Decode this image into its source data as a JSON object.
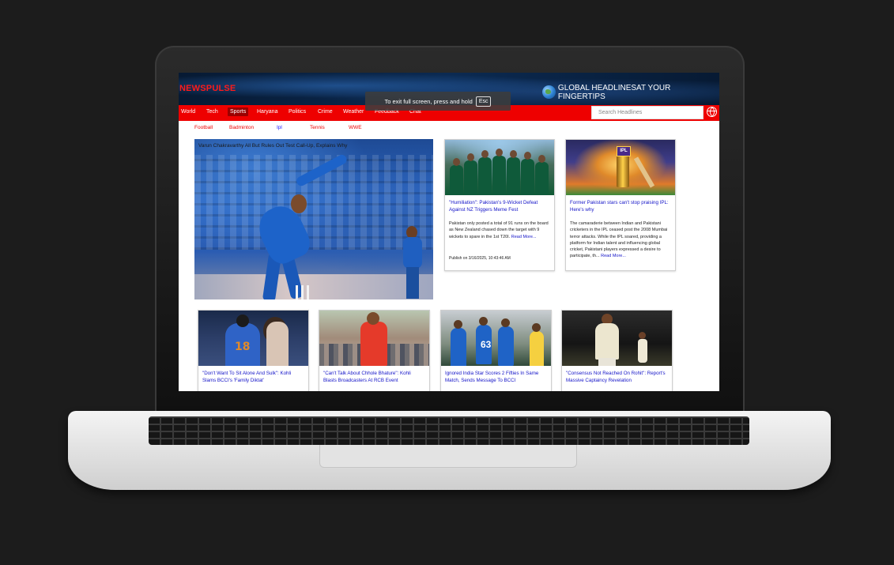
{
  "toast": {
    "text": "To exit full screen, press and hold",
    "key": "Esc"
  },
  "site": {
    "brand": "NEWSPULSE",
    "tagline": "GLOBAL HEADLINESAT YOUR FINGERTIPS"
  },
  "nav": {
    "items": [
      "World",
      "Tech",
      "Sports",
      "Haryana",
      "Politics",
      "Crime",
      "Weather",
      "Feedback",
      "Chat"
    ],
    "active": "Sports",
    "search_placeholder": "Search Headlines"
  },
  "subnav": [
    "Football",
    "Badminton",
    "Ipl",
    "Tennis",
    "WWE"
  ],
  "hero": {
    "title": "Varun Chakravarthy All But Rules Out Test Call-Up, Explains Why"
  },
  "featured": [
    {
      "title": "\"Humiliation\": Pakistan's 9-Wicket Defeat Against NZ Triggers Meme Fest",
      "desc": "Pakistan only posted a total of 91 runs on the board as New Zealand chased down the target with 9 wickets to spare in the 1st T20I.",
      "more": "Read More...",
      "meta": "Publish on 3/16/2025, 10:43:46 AM"
    },
    {
      "title": "Former Pakistan stars can't stop praising IPL: Here's why",
      "desc": "The camaraderie between Indian and Pakistani cricketers in the IPL ceased post the 2008 Mumbai terror attacks. While the IPL soared, providing a platform for Indian talent and influencing global cricket, Pakistani players expressed a desire to participate, th...",
      "more": "Read More..."
    }
  ],
  "row": [
    {
      "title": "\"Don't Want To Sit Alone And Sulk\": Kohli Slams BCCI's 'Family Diktat'"
    },
    {
      "title": "\"Can't Talk About Chhole Bhature\": Kohli Blasts Broadcasters At RCB Event"
    },
    {
      "title": "Ignored India Star Scores 2 Fifties In Same Match, Sends Message To BCCI"
    },
    {
      "title": "\"Consensus Not Reached On Rohit\": Report's Massive Captaincy Revelation"
    }
  ],
  "image_labels": {
    "ipl_badge": "IPL",
    "jersey_18": "18",
    "jersey_63": "63"
  },
  "colors": {
    "nav_bg": "#ee0000",
    "link_blue": "#1414c8",
    "brand_red": "#ff1a1a"
  }
}
